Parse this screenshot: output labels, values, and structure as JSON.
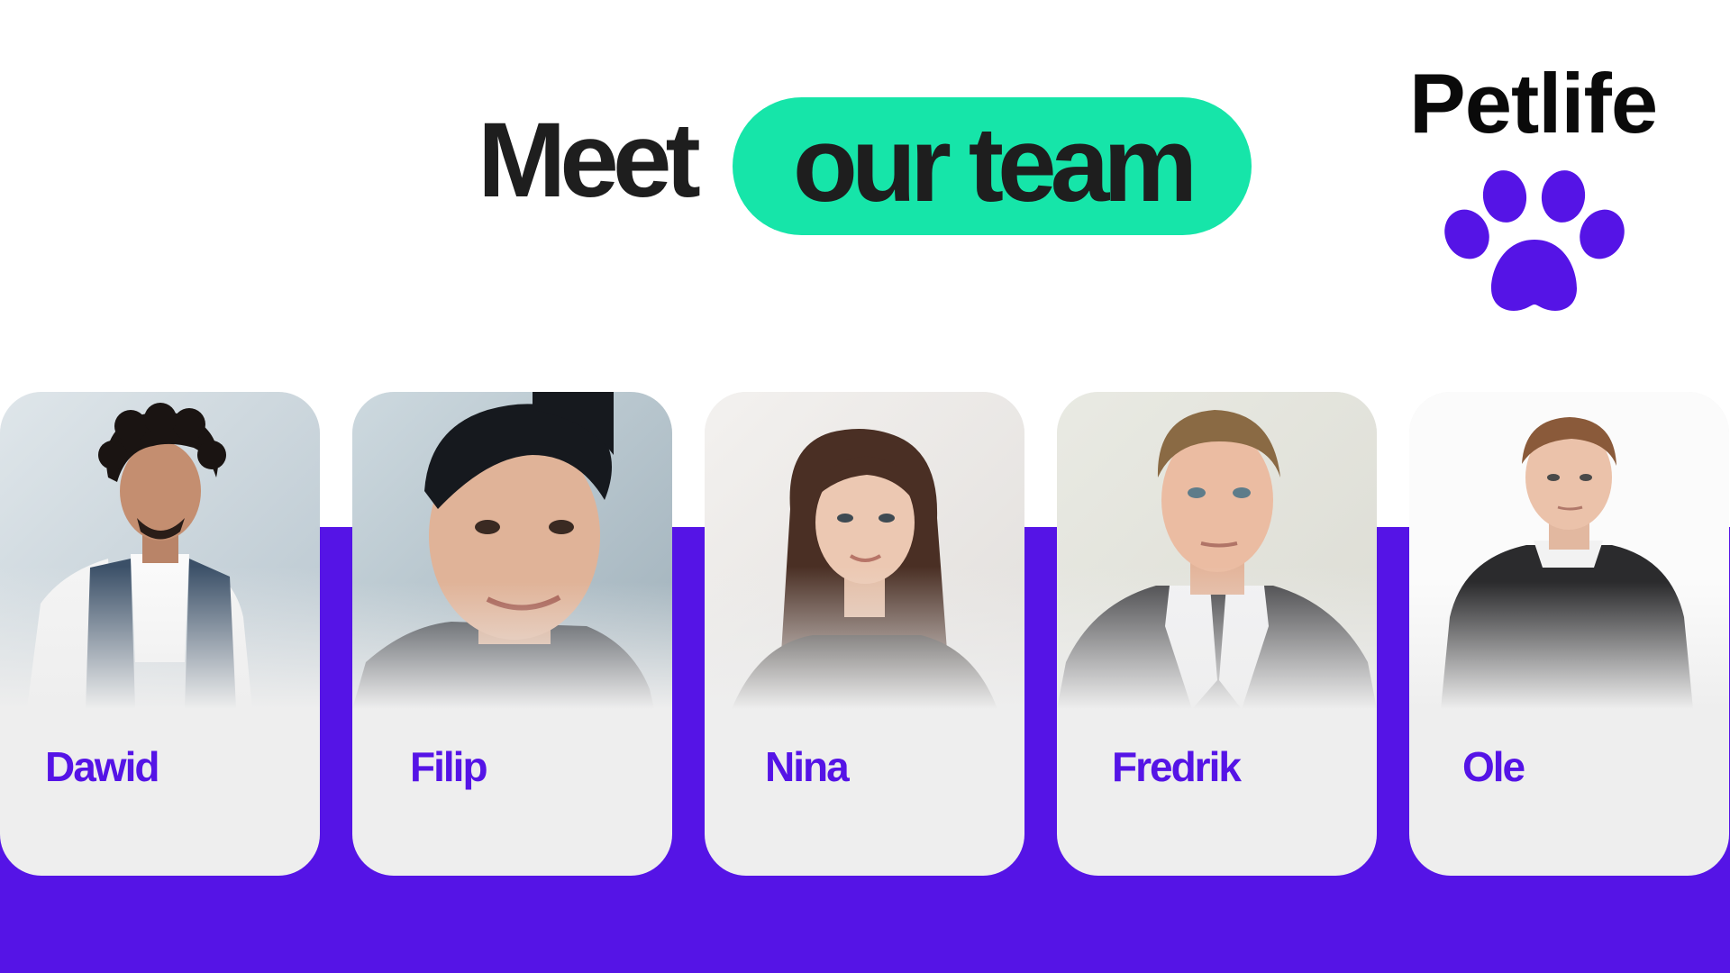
{
  "headline": {
    "lead": "Meet",
    "highlight": "our team"
  },
  "brand": {
    "name": "Petlife",
    "icon": "paw-icon"
  },
  "colors": {
    "accent_purple": "#5514e6",
    "accent_green": "#16e5a9",
    "text_dark": "#1e1e1e",
    "card_bg": "#eeeeee"
  },
  "team": [
    {
      "name": "Dawid",
      "photo": "portrait-photo"
    },
    {
      "name": "Filip",
      "photo": "portrait-photo"
    },
    {
      "name": "Nina",
      "photo": "portrait-photo"
    },
    {
      "name": "Fredrik",
      "photo": "portrait-photo"
    },
    {
      "name": "Ole",
      "photo": "portrait-photo"
    }
  ]
}
